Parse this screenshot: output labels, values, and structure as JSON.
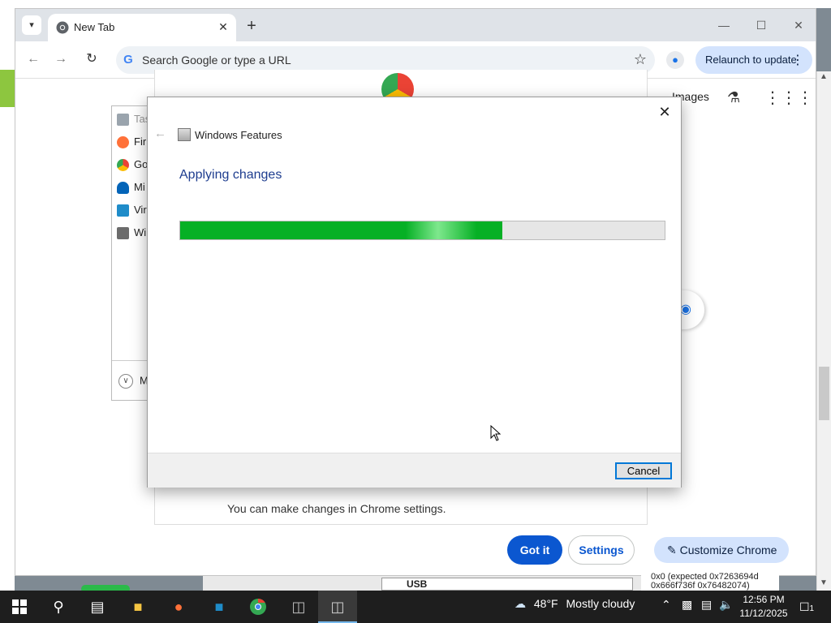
{
  "browser": {
    "tab_title": "New Tab",
    "omnibox_placeholder": "Search Google or type a URL",
    "relaunch_label": "Relaunch to update",
    "images_link": "Images",
    "notice_text": "You can make changes in Chrome settings.",
    "got_it_label": "Got it",
    "settings_label": "Settings",
    "customize_label": "Customize Chrome",
    "google_letter": "G"
  },
  "background_list": {
    "items": [
      {
        "label": "Tas",
        "icon": "taskbar-icon",
        "color": "#9aa4ad"
      },
      {
        "label": "Fir",
        "icon": "firefox-icon",
        "color": "#ff7139"
      },
      {
        "label": "Go",
        "icon": "chrome-icon",
        "color": "#34a853"
      },
      {
        "label": "Mi",
        "icon": "onedrive-icon",
        "color": "#0364b8"
      },
      {
        "label": "Vir",
        "icon": "virtualbox-icon",
        "color": "#1f8cc9"
      },
      {
        "label": "Wi",
        "icon": "windows-features-icon",
        "color": "#6b6b6b"
      }
    ],
    "more_label": "M"
  },
  "dialog": {
    "title": "Windows Features",
    "heading": "Applying changes",
    "progress": 0.665,
    "cancel_label": "Cancel"
  },
  "peek": {
    "usb_label": "USB",
    "code_line1": "0x0 (expected 0x7263694d",
    "code_line2": "0x666f736f 0x76482074)"
  },
  "taskbar": {
    "weather_temp": "48°F",
    "weather_text": "Mostly cloudy",
    "time": "12:56 PM",
    "date": "11/12/2025",
    "notification_count": "1"
  },
  "colors": {
    "accent": "#0b57d0",
    "progress_green": "#06b025",
    "relaunch_bg": "#d3e3fd",
    "taskbar_bg": "#1e1e1e"
  }
}
